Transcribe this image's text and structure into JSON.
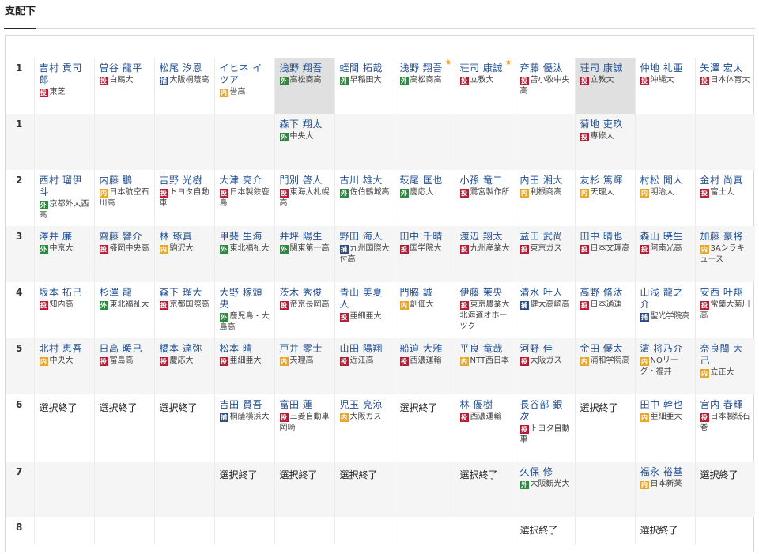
{
  "tab": "支配下",
  "colors": {
    "pitcher": "#b21e35",
    "infielder": "#e3a72f",
    "outfielder": "#2b8a3e",
    "catcher": "#2b4c86",
    "name": "#1f4e91",
    "star": "#f0a020"
  },
  "legend": {
    "投": "pitcher",
    "内": "infielder",
    "外": "outfielder",
    "捕": "catcher"
  },
  "rows": [
    {
      "round": "1",
      "cells": [
        {
          "name": "吉村 貢司郎",
          "pos": "投",
          "school": "東芝"
        },
        {
          "name": "曽谷 龍平",
          "pos": "投",
          "school": "白鴎大"
        },
        {
          "name": "松尾 汐恩",
          "pos": "捕",
          "school": "大阪桐蔭高"
        },
        {
          "name": "イヒネ イツア",
          "pos": "内",
          "school": "誉高"
        },
        {
          "name": "浅野 翔吾",
          "pos": "外",
          "school": "高松商高",
          "hl": true
        },
        {
          "name": "蛭間 拓哉",
          "pos": "外",
          "school": "早稲田大"
        },
        {
          "name": "浅野 翔吾",
          "pos": "外",
          "school": "高松商高",
          "star": true
        },
        {
          "name": "荘司 康誠",
          "pos": "投",
          "school": "立教大",
          "star": true
        },
        {
          "name": "斉藤 優汰",
          "pos": "投",
          "school": "苫小牧中央高"
        },
        {
          "name": "荘司 康誠",
          "pos": "投",
          "school": "立教大",
          "hl": true
        },
        {
          "name": "仲地 礼亜",
          "pos": "投",
          "school": "沖縄大"
        },
        {
          "name": "矢澤 宏太",
          "pos": "投",
          "school": "日本体育大"
        }
      ]
    },
    {
      "round": "1",
      "cells": [
        null,
        null,
        null,
        null,
        {
          "name": "森下 翔太",
          "pos": "外",
          "school": "中央大"
        },
        null,
        null,
        null,
        null,
        {
          "name": "菊地 吏玖",
          "pos": "投",
          "school": "専修大"
        },
        null,
        null
      ]
    },
    {
      "round": "2",
      "cells": [
        {
          "name": "西村 瑠伊斗",
          "pos": "外",
          "school": "京都外大西高"
        },
        {
          "name": "内藤 鵬",
          "pos": "内",
          "school": "日本航空石川高"
        },
        {
          "name": "吉野 光樹",
          "pos": "投",
          "school": "トヨタ自動車"
        },
        {
          "name": "大津 亮介",
          "pos": "投",
          "school": "日本製鉄鹿島"
        },
        {
          "name": "門別 啓人",
          "pos": "投",
          "school": "東海大札幌高"
        },
        {
          "name": "古川 雄大",
          "pos": "外",
          "school": "佐伯鶴城高"
        },
        {
          "name": "萩尾 匡也",
          "pos": "外",
          "school": "慶応大"
        },
        {
          "name": "小孫 竜二",
          "pos": "投",
          "school": "鷺宮製作所"
        },
        {
          "name": "内田 湘大",
          "pos": "内",
          "school": "利根商高"
        },
        {
          "name": "友杉 篤輝",
          "pos": "内",
          "school": "天理大"
        },
        {
          "name": "村松 開人",
          "pos": "内",
          "school": "明治大"
        },
        {
          "name": "金村 尚真",
          "pos": "投",
          "school": "富士大"
        }
      ]
    },
    {
      "round": "3",
      "cells": [
        {
          "name": "澤井 廉",
          "pos": "外",
          "school": "中京大"
        },
        {
          "name": "齋藤 響介",
          "pos": "投",
          "school": "盛岡中央高"
        },
        {
          "name": "林 琢真",
          "pos": "内",
          "school": "駒沢大"
        },
        {
          "name": "甲斐 生海",
          "pos": "外",
          "school": "東北福祉大"
        },
        {
          "name": "井坪 陽生",
          "pos": "外",
          "school": "関東第一高"
        },
        {
          "name": "野田 海人",
          "pos": "捕",
          "school": "九州国際大付高"
        },
        {
          "name": "田中 千晴",
          "pos": "投",
          "school": "国学院大"
        },
        {
          "name": "渡辺 翔太",
          "pos": "投",
          "school": "九州産業大"
        },
        {
          "name": "益田 武尚",
          "pos": "投",
          "school": "東京ガス"
        },
        {
          "name": "田中 晴也",
          "pos": "投",
          "school": "日本文理高"
        },
        {
          "name": "森山 暁生",
          "pos": "投",
          "school": "阿南光高"
        },
        {
          "name": "加藤 豪将",
          "pos": "内",
          "school": "3Aシラキュース"
        }
      ]
    },
    {
      "round": "4",
      "cells": [
        {
          "name": "坂本 拓己",
          "pos": "投",
          "school": "知内高"
        },
        {
          "name": "杉澤 龍",
          "pos": "外",
          "school": "東北福祉大"
        },
        {
          "name": "森下 瑠大",
          "pos": "投",
          "school": "京都国際高"
        },
        {
          "name": "大野 稼頭央",
          "pos": "外",
          "school": "鹿児島・大島高"
        },
        {
          "name": "茨木 秀俊",
          "pos": "投",
          "school": "帝京長岡高"
        },
        {
          "name": "青山 美夏人",
          "pos": "投",
          "school": "亜細亜大"
        },
        {
          "name": "門脇 誠",
          "pos": "内",
          "school": "創価大"
        },
        {
          "name": "伊藤 茉央",
          "pos": "投",
          "school": "東京農業大北海道オホーツク"
        },
        {
          "name": "清水 叶人",
          "pos": "捕",
          "school": "健大高崎高"
        },
        {
          "name": "高野 脩汰",
          "pos": "投",
          "school": "日本通運"
        },
        {
          "name": "山浅 龍之介",
          "pos": "捕",
          "school": "聖光学院高"
        },
        {
          "name": "安西 叶翔",
          "pos": "投",
          "school": "常葉大菊川高"
        }
      ]
    },
    {
      "round": "5",
      "cells": [
        {
          "name": "北村 恵吾",
          "pos": "内",
          "school": "中央大"
        },
        {
          "name": "日高 暖己",
          "pos": "投",
          "school": "富島高"
        },
        {
          "name": "橋本 達弥",
          "pos": "投",
          "school": "慶応大"
        },
        {
          "name": "松本 晴",
          "pos": "投",
          "school": "亜細亜大"
        },
        {
          "name": "戸井 零士",
          "pos": "内",
          "school": "天理高"
        },
        {
          "name": "山田 陽翔",
          "pos": "投",
          "school": "近江高"
        },
        {
          "name": "船迫 大雅",
          "pos": "投",
          "school": "西濃運輸"
        },
        {
          "name": "平良 竜哉",
          "pos": "内",
          "school": "NTT西日本"
        },
        {
          "name": "河野 佳",
          "pos": "投",
          "school": "大阪ガス"
        },
        {
          "name": "金田 優太",
          "pos": "内",
          "school": "浦和学院高"
        },
        {
          "name": "濵 将乃介",
          "pos": "内",
          "school": "NOリーグ・福井"
        },
        {
          "name": "奈良間 大己",
          "pos": "内",
          "school": "立正大"
        }
      ]
    },
    {
      "round": "6",
      "cells": [
        {
          "done": "選択終了"
        },
        {
          "done": "選択終了"
        },
        {
          "done": "選択終了"
        },
        {
          "name": "吉田 賢吾",
          "pos": "捕",
          "school": "桐蔭横浜大"
        },
        {
          "name": "富田 蓮",
          "pos": "投",
          "school": "三菱自動車岡崎"
        },
        {
          "name": "児玉 亮涼",
          "pos": "内",
          "school": "大阪ガス"
        },
        {
          "done": "選択終了"
        },
        {
          "name": "林 優樹",
          "pos": "投",
          "school": "西濃運輸"
        },
        {
          "name": "長谷部 銀次",
          "pos": "投",
          "school": "トヨタ自動車"
        },
        {
          "done": "選択終了"
        },
        {
          "name": "田中 幹也",
          "pos": "内",
          "school": "亜細亜大"
        },
        {
          "name": "宮内 春輝",
          "pos": "投",
          "school": "日本製紙石巻"
        }
      ]
    },
    {
      "round": "7",
      "cells": [
        null,
        null,
        null,
        {
          "done": "選択終了"
        },
        {
          "done": "選択終了"
        },
        {
          "done": "選択終了"
        },
        null,
        {
          "done": "選択終了"
        },
        {
          "name": "久保 修",
          "pos": "外",
          "school": "大阪観光大"
        },
        null,
        {
          "name": "福永 裕基",
          "pos": "内",
          "school": "日本新薬"
        },
        {
          "done": "選択終了"
        }
      ]
    },
    {
      "round": "8",
      "cells": [
        null,
        null,
        null,
        null,
        null,
        null,
        null,
        null,
        {
          "done": "選択終了"
        },
        null,
        {
          "done": "選択終了"
        },
        null
      ]
    }
  ]
}
